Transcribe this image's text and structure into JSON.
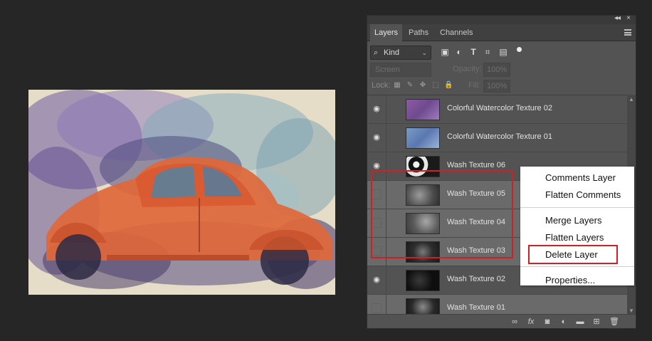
{
  "panel": {
    "tabs": [
      {
        "label": "Layers",
        "active": true
      },
      {
        "label": "Paths",
        "active": false
      },
      {
        "label": "Channels",
        "active": false
      }
    ],
    "filter": {
      "kind_label": "Kind",
      "icons": [
        "image-filter-icon",
        "adjustment-filter-icon",
        "type-filter-icon",
        "shape-filter-icon",
        "smart-object-filter-icon",
        "filter-toggle-icon"
      ]
    },
    "blend_mode": "Screen",
    "opacity_label": "Opacity:",
    "opacity_value": "100%",
    "lock_label": "Lock:",
    "fill_label": "Fill:",
    "fill_value": "100%",
    "layers": [
      {
        "name": "Colorful Watercolor Texture 02",
        "visible": true,
        "selected": false,
        "thumb": "purple-texture"
      },
      {
        "name": "Colorful Watercolor Texture 01",
        "visible": true,
        "selected": false,
        "thumb": "blue-texture"
      },
      {
        "name": "Wash Texture 06",
        "visible": true,
        "selected": false,
        "thumb": "black-white-texture"
      },
      {
        "name": "Wash Texture 05",
        "visible": false,
        "selected": true,
        "thumb": "gray-texture"
      },
      {
        "name": "Wash Texture 04",
        "visible": false,
        "selected": true,
        "thumb": "gray-texture"
      },
      {
        "name": "Wash Texture 03",
        "visible": false,
        "selected": true,
        "thumb": "dark-texture"
      },
      {
        "name": "Wash Texture 02",
        "visible": true,
        "selected": false,
        "thumb": "black-texture"
      },
      {
        "name": "Wash Texture 01",
        "visible": false,
        "selected": true,
        "thumb": "dark-texture"
      }
    ],
    "bottom_icons": [
      "link-icon",
      "fx-icon",
      "mask-icon",
      "adjustment-icon",
      "folder-icon",
      "new-layer-icon",
      "trash-icon"
    ]
  },
  "context_menu": {
    "items": [
      {
        "label": "Comments Layer"
      },
      {
        "label": "Flatten Comments"
      },
      {
        "label": "Merge Layers"
      },
      {
        "label": "Flatten Layers"
      },
      {
        "label": "Delete Layer",
        "highlighted": true
      },
      {
        "label": "Properties..."
      }
    ]
  },
  "colors": {
    "highlight_red": "#d01f25",
    "panel_bg": "#535353",
    "app_bg": "#262626"
  }
}
